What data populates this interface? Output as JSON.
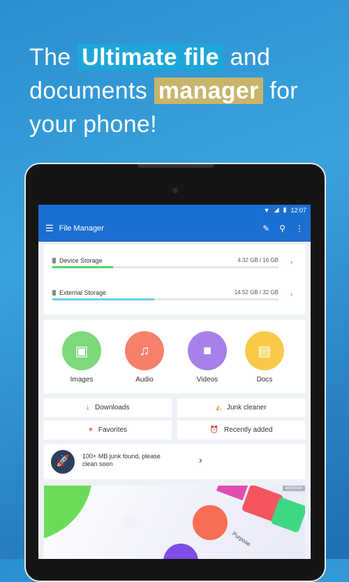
{
  "headline": {
    "pre": "The ",
    "highlight1": "Ultimate file",
    "mid1": " and",
    "line2_pre": "documents ",
    "highlight2": "manager",
    "line2_post": " for",
    "line3": "your phone!"
  },
  "status_bar": {
    "time": "12:07",
    "icons": [
      "wifi-icon",
      "signal-icon",
      "battery-icon"
    ]
  },
  "app_bar": {
    "title": "File Manager",
    "icons": [
      "menu-icon",
      "cleaner-icon",
      "search-icon",
      "more-vert-icon"
    ]
  },
  "storage": [
    {
      "label": "Device Storage",
      "amount": "4.32 GB / 16 GB",
      "used_fraction": 0.27,
      "color": "#4cd964"
    },
    {
      "label": "External Storage",
      "amount": "14.52 GB / 32 GB",
      "used_fraction": 0.45,
      "color": "#6ccff0"
    }
  ],
  "categories": [
    {
      "label": "Images",
      "color": "#7ed87c",
      "icon": "image-icon"
    },
    {
      "label": "Audio",
      "color": "#f5806c",
      "icon": "music-icon"
    },
    {
      "label": "Videos",
      "color": "#a681ea",
      "icon": "video-icon"
    },
    {
      "label": "Docs",
      "color": "#f7cb48",
      "icon": "doc-icon"
    }
  ],
  "quick": [
    {
      "label": "Downloads",
      "icon": "download-icon"
    },
    {
      "label": "Junk cleaner",
      "icon": "broom-icon"
    },
    {
      "label": "Favorites",
      "icon": "heart-icon"
    },
    {
      "label": "Recently added",
      "icon": "alarm-icon"
    }
  ],
  "junk_card": {
    "text": "100+ MB junk found, please clean soon"
  },
  "ad": {
    "badge": "adchoice",
    "caption": "Purpose"
  }
}
